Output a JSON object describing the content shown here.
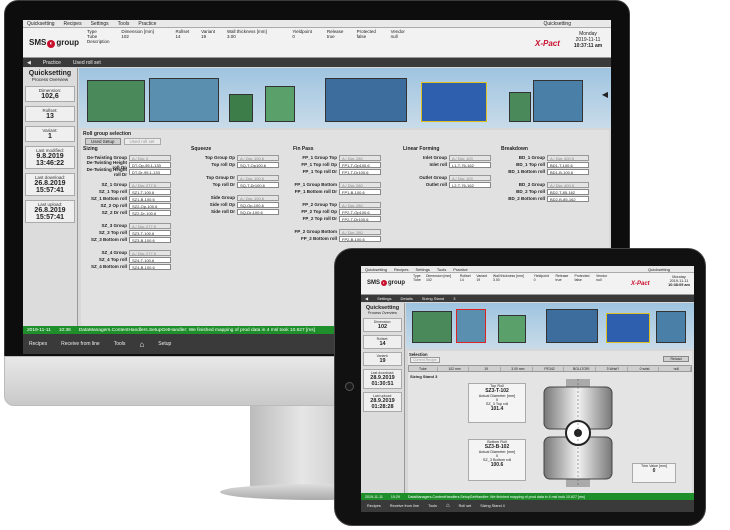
{
  "main": {
    "menu": [
      "Quicksetting",
      "Recipes",
      "Settings",
      "Tools",
      "Practice"
    ],
    "menu_right": "Quicksetting",
    "logo_text": "SMS",
    "logo_group": "group",
    "header_table": {
      "columns": [
        "Type",
        "Dimension [mm]",
        "Rollset",
        "Variant",
        "Wall thickness [mm]",
        "Yieldpoint",
        "Release",
        "Protected",
        "Vendor"
      ],
      "row": [
        "Tube",
        "102",
        "14",
        "19",
        "3.00",
        "0",
        "true",
        "false",
        "null"
      ],
      "row2": [
        "Description"
      ]
    },
    "brand": "X-Pact",
    "date_day": "Monday",
    "date": "2019-11-11",
    "time": "10:37:11 am",
    "nav": [
      "Practice",
      "Used roll set"
    ],
    "left": {
      "title": "Quicksetting",
      "subtitle": "Process Overview",
      "tiles": [
        {
          "label": "Dimension:",
          "value": "102,6"
        },
        {
          "label": "Rollset:",
          "value": "13"
        },
        {
          "label": "Variant:",
          "value": "1"
        },
        {
          "label": "Last modified:",
          "value": "9.8.2019",
          "value2": "13:46:22"
        },
        {
          "label": "Last download:",
          "value": "26.8.2019",
          "value2": "15:57:41"
        },
        {
          "label": "Last upload:",
          "value": "26.8.2019",
          "value2": "15:57:41"
        }
      ]
    },
    "roll_group_selection": "Roll group selection",
    "buttons": [
      "Used Setup",
      "Used roll set"
    ],
    "sections": {
      "sizing": {
        "title": "Sizing",
        "fields": [
          {
            "n": "De-Twisting Group",
            "sel": "A / Dia: 0"
          },
          {
            "n": "De-Twisting Height roll Op",
            "box": "DT-Op-95.1-133"
          },
          {
            "n": "De-Twisting Height roll Dr",
            "box": "DT-Dr-95.1-133"
          },
          {
            "n": "SZ_1 Group",
            "sel": "A / Dia: 277.5"
          },
          {
            "n": "SZ_1 Top roll",
            "box": "SZ1-T-100.6"
          },
          {
            "n": "SZ_1 Bottom roll",
            "box": "SZ1-B-100.6"
          },
          {
            "n": "SZ_2 Op roll",
            "box": "SZ2-Op-100.6"
          },
          {
            "n": "SZ_2 Dr roll",
            "box": "SZ2-Dr-100.6"
          },
          {
            "n": "SZ_3 Group",
            "sel": "A / Dia: 277.5"
          },
          {
            "n": "SZ_3 Top roll",
            "box": "SZ3-T-100.6"
          },
          {
            "n": "SZ_3 Bottom roll",
            "box": "SZ3-B-100.6"
          },
          {
            "n": "SZ_4 Group",
            "sel": "A / Dia: 277.5"
          },
          {
            "n": "SZ_4 Top roll",
            "box": "SZ4-T-100.6"
          },
          {
            "n": "SZ_4 Bottom roll",
            "box": "SZ4-B-100.6"
          }
        ]
      },
      "squeeze": {
        "title": "Squeeze",
        "fields": [
          {
            "n": "Top Group Op",
            "sel": "A / Dia: 100.6"
          },
          {
            "n": "Top roll Op",
            "box": "SQ-T-Op100.6"
          },
          {
            "n": "Top Group Dr",
            "sel": "A / Dia: 100.6"
          },
          {
            "n": "Top roll Dr",
            "box": "SQ-T-Dr100.6"
          },
          {
            "n": "Side Group",
            "sel": "A / Dia: 100.6"
          },
          {
            "n": "Side roll Op",
            "box": "SQ-Op-100.6"
          },
          {
            "n": "Side roll Dr",
            "box": "SQ-Dr-100.6"
          }
        ]
      },
      "finpass": {
        "title": "Fin Pass",
        "fields": [
          {
            "n": "FP_1 Group Top",
            "sel": "A / Dia: 280"
          },
          {
            "n": "FP_1 Top roll Op",
            "box": "FP1-T-Op100.6"
          },
          {
            "n": "FP_1 Top roll Dr",
            "box": "FP1-T-Dr100.6"
          },
          {
            "n": "FP_1 Group Bottom",
            "sel": "A / Dia: 280"
          },
          {
            "n": "FP_1 Bottom roll Dr",
            "box": "FP1-B-100.6"
          },
          {
            "n": "FP_2 Group Top",
            "sel": "A / Dia: 280"
          },
          {
            "n": "FP_2 Top roll Op",
            "box": "FP2-T-Op100.6"
          },
          {
            "n": "FP_2 Top roll Dr",
            "box": "FP2-T-Dr100.6"
          },
          {
            "n": "FP_2 Group Bottom",
            "sel": "A / Dia: 280"
          },
          {
            "n": "FP_2 Bottom roll",
            "box": "FP2-B-100.6"
          }
        ]
      },
      "linear": {
        "title": "Linear Forming",
        "fields": [
          {
            "n": "Inlet Group",
            "sel": "A / Dia: 103"
          },
          {
            "n": "Inlet roll",
            "box": "L1-T-76-162"
          },
          {
            "n": "Outlet Group",
            "sel": "A / Dia: 103"
          },
          {
            "n": "Outlet roll",
            "box": "L2-T-76-162"
          }
        ]
      },
      "breakdown": {
        "title": "Breakdown",
        "fields": [
          {
            "n": "BD_1 Group",
            "sel": "A / Dia: 400.5"
          },
          {
            "n": "BD_1 Top roll",
            "box": "BD1-T-100.6"
          },
          {
            "n": "BD_1 Bottom roll",
            "box": "BD1-B-100.6"
          },
          {
            "n": "BD_2 Group",
            "sel": "A / Dia: 400.5"
          },
          {
            "n": "BD_2 Top roll",
            "box": "BD2-T-85-162"
          },
          {
            "n": "BD_2 Bottom roll",
            "box": "BD2-B-85-162"
          }
        ]
      }
    },
    "status": {
      "date": "2019-11-11",
      "time": "10:36",
      "msg": "DataManagers.ContentHandlers.SetupGetHandler: We finished mapping of prod data in 4 msl took 10.627 [ms]"
    },
    "bottom_nav": [
      "Recipes",
      "Receive from line",
      "Tools",
      "Setup"
    ]
  },
  "tablet": {
    "menu": [
      "Quicksetting",
      "Recipes",
      "Settings",
      "Tools",
      "Practice"
    ],
    "menu_right": "Quicksetting",
    "header_table": {
      "columns": [
        "Type",
        "Dimension [mm]",
        "Rollset",
        "Variant",
        "Wall thickness [mm]",
        "Yieldpoint",
        "Release",
        "Protected",
        "Vendor"
      ],
      "row": [
        "Tube",
        "102",
        "14",
        "19",
        "3.00",
        "0",
        "true",
        "false",
        "null"
      ]
    },
    "date_day": "Monday",
    "date": "2019-11-11",
    "time": "10:38:09 am",
    "nav": [
      "Settings",
      "Details",
      "Sizing Stand",
      "3"
    ],
    "left": {
      "title": "Quicksetting",
      "subtitle": "Process Overview",
      "tiles": [
        {
          "label": "Dimension:",
          "value": "102"
        },
        {
          "label": "Rollset:",
          "value": "14"
        },
        {
          "label": "Variant:",
          "value": "19"
        },
        {
          "label": "Last download:",
          "value": "28.9.2019",
          "value2": "01:30:51"
        },
        {
          "label": "Last upload:",
          "value": "28.9.2019",
          "value2": "01:28:28"
        }
      ]
    },
    "selection": "Selection",
    "reload": "Reload",
    "current_recipe": "Current Recipe",
    "strip": [
      "Tube",
      "102 mm",
      "19",
      "3.00 mm",
      "PE342",
      "BOLLTORI",
      "3 Wrist?",
      "0 wrist",
      "null"
    ],
    "stand_title": "Sizing Stand 3",
    "top_roll": {
      "label": "Top Roll",
      "id": "SZ3-T-102",
      "diam_label": "Actual Diameter [mm]",
      "diam": "0",
      "sub_label": "SZ_3 Top roll",
      "value": "101.4"
    },
    "bottom_roll": {
      "label": "Bottom Roll",
      "id": "SZ3-B-102",
      "diam_label": "Actual Diameter [mm]",
      "diam": "0",
      "sub_label": "SZ_3 Bottom roll",
      "value": "100.6"
    },
    "trim": {
      "label": "Trim Value [mm]",
      "value": "0"
    },
    "status": {
      "date": "2019-11-11",
      "time": "10:29",
      "msg": "DataManagers.ContentHandlers.SetupGetHandler: We finished mapping of prod data in 4 msl took 10.627 [ms]"
    },
    "bottom_nav": [
      "Recipes",
      "Receive from line",
      "Tools",
      "Roll set",
      "Sizing Stand 4"
    ]
  }
}
